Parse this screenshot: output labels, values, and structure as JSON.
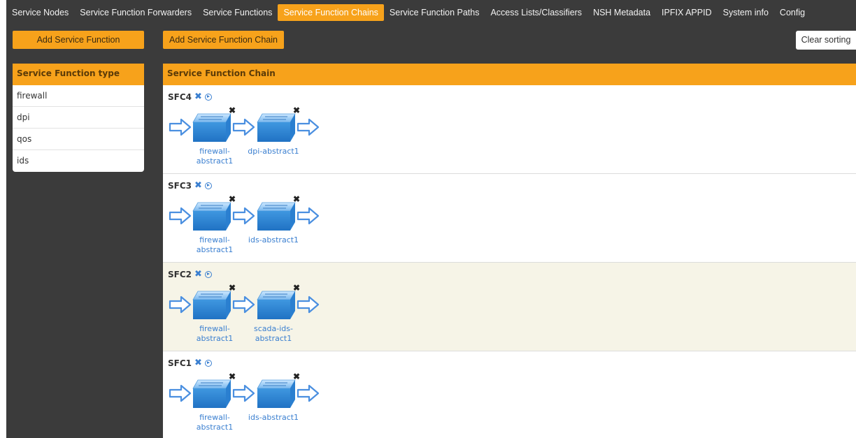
{
  "nav": {
    "tabs": [
      {
        "label": "Service Nodes"
      },
      {
        "label": "Service Function Forwarders"
      },
      {
        "label": "Service Functions"
      },
      {
        "label": "Service Function Chains"
      },
      {
        "label": "Service Function Paths"
      },
      {
        "label": "Access Lists/Classifiers"
      },
      {
        "label": "NSH Metadata"
      },
      {
        "label": "IPFIX APPID"
      },
      {
        "label": "System info"
      },
      {
        "label": "Config"
      }
    ],
    "active_tab": "Service Function Chains"
  },
  "toolbar": {
    "add_sf_label": "Add Service Function",
    "add_sfc_label": "Add Service Function Chain",
    "clear_sorting_label": "Clear sorting"
  },
  "sf_types": {
    "header": "Service Function type",
    "items": [
      {
        "label": "firewall"
      },
      {
        "label": "dpi"
      },
      {
        "label": "qos"
      },
      {
        "label": "ids"
      }
    ]
  },
  "chains": {
    "header": "Service Function Chain",
    "items": [
      {
        "name": "SFC4",
        "functions": [
          {
            "l1": "firewall-",
            "l2": "abstract1"
          },
          {
            "l1": "dpi-abstract1",
            "l2": ""
          }
        ]
      },
      {
        "name": "SFC3",
        "functions": [
          {
            "l1": "firewall-",
            "l2": "abstract1"
          },
          {
            "l1": "ids-abstract1",
            "l2": ""
          }
        ]
      },
      {
        "name": "SFC2",
        "functions": [
          {
            "l1": "firewall-",
            "l2": "abstract1"
          },
          {
            "l1": "scada-ids-",
            "l2": "abstract1"
          }
        ]
      },
      {
        "name": "SFC1",
        "functions": [
          {
            "l1": "firewall-",
            "l2": "abstract1"
          },
          {
            "l1": "ids-abstract1",
            "l2": ""
          }
        ]
      }
    ]
  },
  "colors": {
    "accent": "#f7a21b",
    "background": "#3b3b3b",
    "link": "#3a7fd0",
    "highlight_row": "#f6f4e7"
  },
  "icons": {
    "remove": "close-icon",
    "view": "play-circle-icon",
    "switch": "switch-icon",
    "arrow": "right-arrow-icon"
  }
}
